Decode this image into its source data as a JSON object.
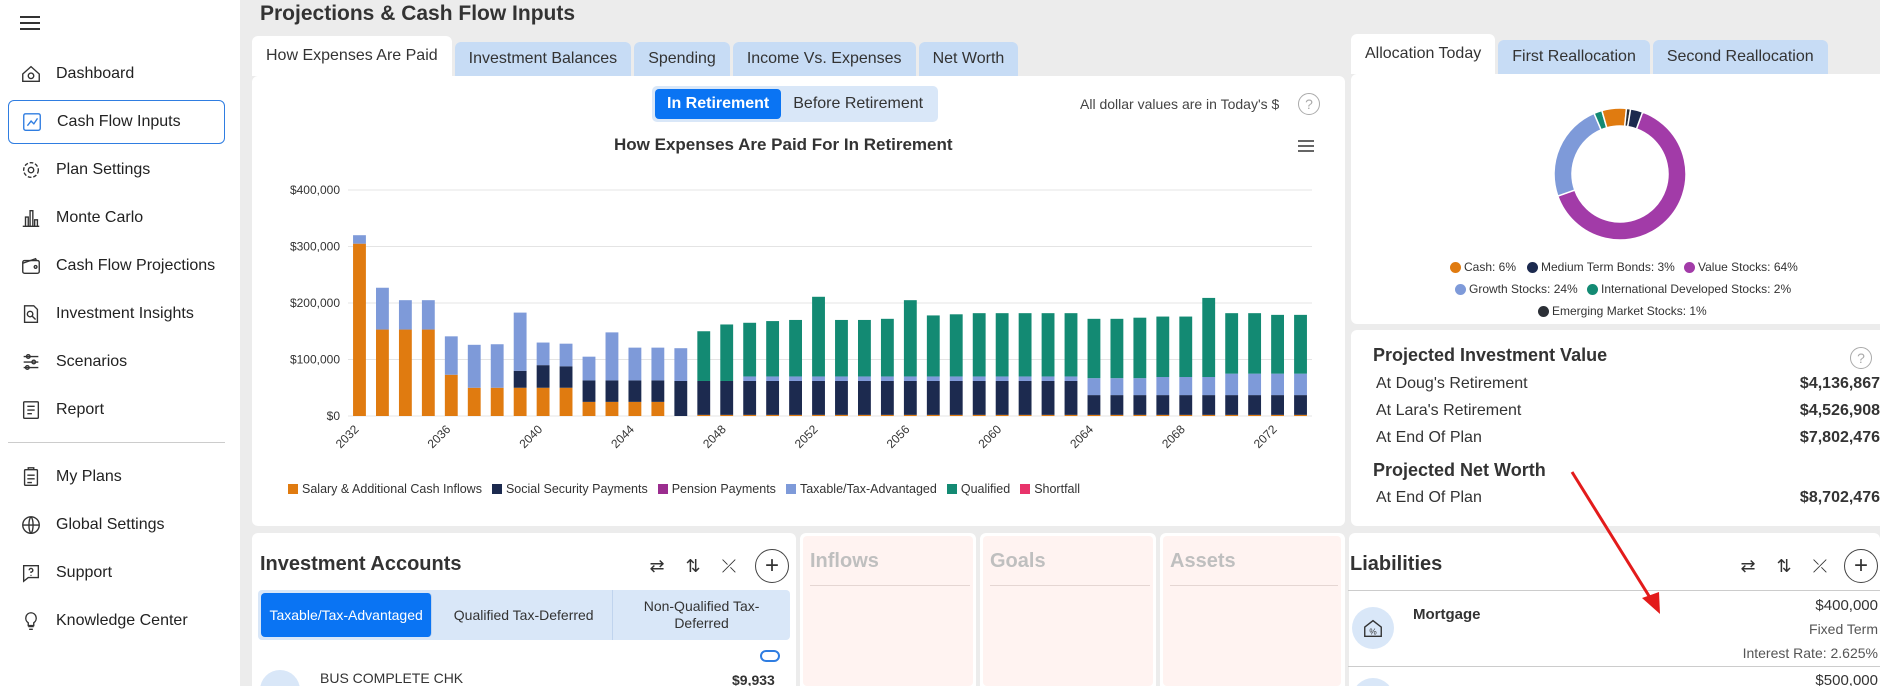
{
  "sidebar": {
    "items": [
      {
        "label": "Dashboard",
        "icon": "dashboard-icon"
      },
      {
        "label": "Cash Flow Inputs",
        "icon": "cash-flow-inputs-icon",
        "active": true
      },
      {
        "label": "Plan Settings",
        "icon": "gear-icon"
      },
      {
        "label": "Monte Carlo",
        "icon": "bar-chart-icon"
      },
      {
        "label": "Cash Flow Projections",
        "icon": "wallet-icon"
      },
      {
        "label": "Investment Insights",
        "icon": "magnifier-document-icon"
      },
      {
        "label": "Scenarios",
        "icon": "sliders-icon"
      },
      {
        "label": "Report",
        "icon": "report-icon"
      },
      {
        "label": "My Plans",
        "icon": "clipboard-icon"
      },
      {
        "label": "Global Settings",
        "icon": "globe-icon"
      },
      {
        "label": "Support",
        "icon": "chat-question-icon"
      },
      {
        "label": "Knowledge Center",
        "icon": "lightbulb-icon"
      }
    ]
  },
  "page": {
    "title": "Projections & Cash Flow Inputs"
  },
  "main_tabs": [
    "How Expenses Are Paid",
    "Investment Balances",
    "Spending",
    "Income Vs. Expenses",
    "Net Worth"
  ],
  "toggle": {
    "in_retirement": "In Retirement",
    "before_retirement": "Before Retirement"
  },
  "dollar_note": "All dollar values are in Today's $",
  "help_symbol": "?",
  "chart_data": {
    "type": "bar",
    "stacked": true,
    "title": "How Expenses Are Paid For In Retirement",
    "xlabel": "",
    "ylabel": "",
    "ylim": [
      0,
      400000
    ],
    "y_ticks": [
      "$0",
      "$100,000",
      "$200,000",
      "$300,000",
      "$400,000"
    ],
    "x_tick_labels": [
      "2032",
      "2036",
      "2040",
      "2044",
      "2048",
      "2052",
      "2056",
      "2060",
      "2064",
      "2068",
      "2072"
    ],
    "x": [
      2032,
      2033,
      2034,
      2035,
      2036,
      2037,
      2038,
      2039,
      2040,
      2041,
      2042,
      2043,
      2044,
      2045,
      2046,
      2047,
      2048,
      2049,
      2050,
      2051,
      2052,
      2053,
      2054,
      2055,
      2056,
      2057,
      2058,
      2059,
      2060,
      2061,
      2062,
      2063,
      2064,
      2065,
      2066,
      2067,
      2068,
      2069,
      2070,
      2071,
      2072,
      2073
    ],
    "series": [
      {
        "name": "Salary & Additional Cash Inflows",
        "color": "#e07b10",
        "values": [
          305000,
          153000,
          153000,
          153000,
          73000,
          50000,
          50000,
          50000,
          50000,
          50000,
          25000,
          25000,
          25000,
          25000,
          0,
          2000,
          2000,
          2000,
          2000,
          2000,
          2000,
          2000,
          2000,
          2000,
          2000,
          2000,
          2000,
          2000,
          2000,
          2000,
          2000,
          2000,
          2000,
          2000,
          2000,
          2000,
          2000,
          2000,
          2000,
          2000,
          2000,
          2000
        ]
      },
      {
        "name": "Social Security Payments",
        "color": "#1c2a4f",
        "values": [
          0,
          0,
          0,
          0,
          0,
          0,
          0,
          30000,
          40000,
          38000,
          38000,
          38000,
          38000,
          38000,
          62000,
          60000,
          60000,
          60000,
          60000,
          60000,
          60000,
          60000,
          60000,
          60000,
          60000,
          60000,
          60000,
          60000,
          60000,
          60000,
          60000,
          60000,
          35000,
          35000,
          35000,
          35000,
          35000,
          35000,
          35000,
          35000,
          35000,
          35000
        ]
      },
      {
        "name": "Pension Payments",
        "color": "#9b2d8f",
        "values": [
          0,
          0,
          0,
          0,
          0,
          0,
          0,
          0,
          0,
          0,
          0,
          0,
          0,
          0,
          0,
          0,
          0,
          0,
          0,
          0,
          0,
          0,
          0,
          0,
          0,
          0,
          0,
          0,
          0,
          0,
          0,
          0,
          0,
          0,
          0,
          0,
          0,
          0,
          0,
          0,
          0,
          0
        ]
      },
      {
        "name": "Taxable/Tax-Advantaged",
        "color": "#7e9ad9",
        "values": [
          15000,
          74000,
          52000,
          52000,
          68000,
          76000,
          77000,
          103000,
          40000,
          40000,
          42000,
          85000,
          58000,
          58000,
          58000,
          0,
          0,
          8000,
          8000,
          8000,
          8000,
          8000,
          8000,
          8000,
          8000,
          8000,
          8000,
          8000,
          8000,
          8000,
          8000,
          8000,
          30000,
          30000,
          30000,
          32000,
          32000,
          32000,
          38000,
          38000,
          38000,
          38000
        ]
      },
      {
        "name": "Qualified",
        "color": "#138a73",
        "values": [
          0,
          0,
          0,
          0,
          0,
          0,
          0,
          0,
          0,
          0,
          0,
          0,
          0,
          0,
          0,
          88000,
          100000,
          95000,
          98000,
          100000,
          141000,
          100000,
          100000,
          102000,
          135000,
          108000,
          110000,
          112000,
          112000,
          112000,
          112000,
          112000,
          105000,
          105000,
          107000,
          107000,
          107000,
          140000,
          107000,
          107000,
          104000,
          104000
        ]
      },
      {
        "name": "Shortfall",
        "color": "#e8336b",
        "values": [
          0,
          0,
          0,
          0,
          0,
          0,
          0,
          0,
          0,
          0,
          0,
          0,
          0,
          0,
          0,
          0,
          0,
          0,
          0,
          0,
          0,
          0,
          0,
          0,
          0,
          0,
          0,
          0,
          0,
          0,
          0,
          0,
          0,
          0,
          0,
          0,
          0,
          0,
          0,
          0,
          0,
          0
        ]
      }
    ]
  },
  "allocation_tabs": [
    "Allocation Today",
    "First Reallocation",
    "Second Reallocation"
  ],
  "allocation": {
    "type": "pie",
    "slices": [
      {
        "label": "Cash: 6%",
        "value": 6,
        "color": "#e07b10"
      },
      {
        "label": "Medium Term Bonds: 3%",
        "value": 3,
        "color": "#1c2a4f"
      },
      {
        "label": "Value Stocks: 64%",
        "value": 64,
        "color": "#a23ba8"
      },
      {
        "label": "Growth Stocks: 24%",
        "value": 24,
        "color": "#7e9ad9"
      },
      {
        "label": "International Developed Stocks: 2%",
        "value": 2,
        "color": "#138a73"
      },
      {
        "label": "Emerging Market Stocks: 1%",
        "value": 1,
        "color": "#2b2f36"
      }
    ]
  },
  "projected": {
    "investment_title": "Projected Investment Value",
    "rows": [
      {
        "label": "At Doug's Retirement",
        "value": "$4,136,867"
      },
      {
        "label": "At Lara's Retirement",
        "value": "$4,526,908"
      },
      {
        "label": "At End Of Plan",
        "value": "$7,802,476"
      }
    ],
    "net_worth_title": "Projected Net Worth",
    "net_worth_rows": [
      {
        "label": "At End Of Plan",
        "value": "$8,702,476"
      }
    ]
  },
  "investment_accounts": {
    "title": "Investment Accounts",
    "tabs": [
      "Taxable/Tax-Advantaged",
      "Qualified Tax-Deferred",
      "Non-Qualified Tax-Deferred"
    ],
    "first_account": {
      "name": "BUS COMPLETE CHK",
      "value": "$9,933"
    }
  },
  "inflows": {
    "title": "Inflows"
  },
  "goals": {
    "title": "Goals"
  },
  "assets": {
    "title": "Assets"
  },
  "liabilities": {
    "title": "Liabilities",
    "items": [
      {
        "name": "Mortgage",
        "amount": "$400,000",
        "type": "Fixed Term",
        "rate": "Interest Rate: 2.625%"
      },
      {
        "amount": "$500,000"
      }
    ]
  }
}
